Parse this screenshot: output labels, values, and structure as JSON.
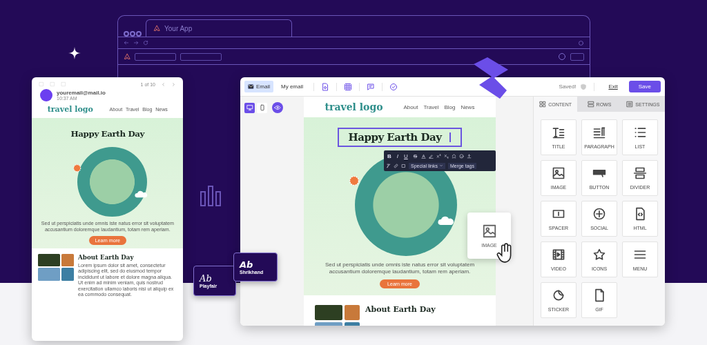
{
  "browser": {
    "tab_title": "Your App"
  },
  "mail_preview": {
    "pager": "1 of 10",
    "sender": "youremail@mail.io",
    "time": "10:37 AM",
    "email": {
      "logo": "travel logo",
      "nav": [
        "About",
        "Travel",
        "Blog",
        "News"
      ],
      "heading": "Happy Earth Day",
      "body": "Sed ut perspiciatis unde omnis iste natus error sit voluptatem accusantium doloremque laudantium, totam rem aperiam.",
      "button": "Learn more",
      "about_title": "About Earth Day",
      "about_text": "Lorem ipsum dolor sit amet, consectetur adipiscing elit, sed do eiusmod tempor incididunt ut labore et dolore magna aliqua. Ut enim ad minim veniam, quis nostrud exercitation ullamco laboris nisi ut aliquip ex ea commodo consequat."
    }
  },
  "editor": {
    "tabs": [
      {
        "label": "Email",
        "selected": true
      },
      {
        "label": "My email",
        "selected": false
      }
    ],
    "status": "Saved!",
    "exit": "Exit",
    "save": "Save",
    "devices": [
      {
        "kind": "desktop",
        "selected": true
      },
      {
        "kind": "mobile",
        "selected": false
      }
    ],
    "email": {
      "logo": "travel logo",
      "nav": [
        "About",
        "Travel",
        "Blog",
        "News"
      ],
      "heading": "Happy Earth Day",
      "body": "Sed ut perspiciatis unde omnis iste natus error sit voluptatem accusantium doloremque laudantium, totam rem aperiam.",
      "button": "Learn more",
      "about_title": "About Earth Day"
    },
    "format_toolbar": {
      "buttons": [
        "B",
        "I",
        "U",
        "S"
      ],
      "special_links": "Special links",
      "merge_tags": "Merge tags"
    },
    "panel_tabs": [
      {
        "label": "CONTENT",
        "kind": "content",
        "selected": true
      },
      {
        "label": "ROWS",
        "kind": "rows",
        "selected": false
      },
      {
        "label": "SETTINGS",
        "kind": "settings",
        "selected": false
      }
    ],
    "blocks": [
      {
        "label": "TITLE",
        "kind": "title"
      },
      {
        "label": "PARAGRAPH",
        "kind": "paragraph"
      },
      {
        "label": "LIST",
        "kind": "list"
      },
      {
        "label": "IMAGE",
        "kind": "image"
      },
      {
        "label": "BUTTON",
        "kind": "button"
      },
      {
        "label": "DIVIDER",
        "kind": "divider"
      },
      {
        "label": "SPACER",
        "kind": "spacer"
      },
      {
        "label": "SOCIAL",
        "kind": "social"
      },
      {
        "label": "HTML",
        "kind": "html"
      },
      {
        "label": "VIDEO",
        "kind": "video"
      },
      {
        "label": "ICONS",
        "kind": "icons"
      },
      {
        "label": "MENU",
        "kind": "menu"
      },
      {
        "label": "STICKER",
        "kind": "sticker"
      },
      {
        "label": "GIF",
        "kind": "gif"
      }
    ]
  },
  "dragged_block": {
    "label": "IMAGE"
  },
  "font_cards": [
    {
      "sample": "Ab",
      "name": "Playfair"
    },
    {
      "sample": "Ab",
      "name": "Shrikhand"
    }
  ]
}
